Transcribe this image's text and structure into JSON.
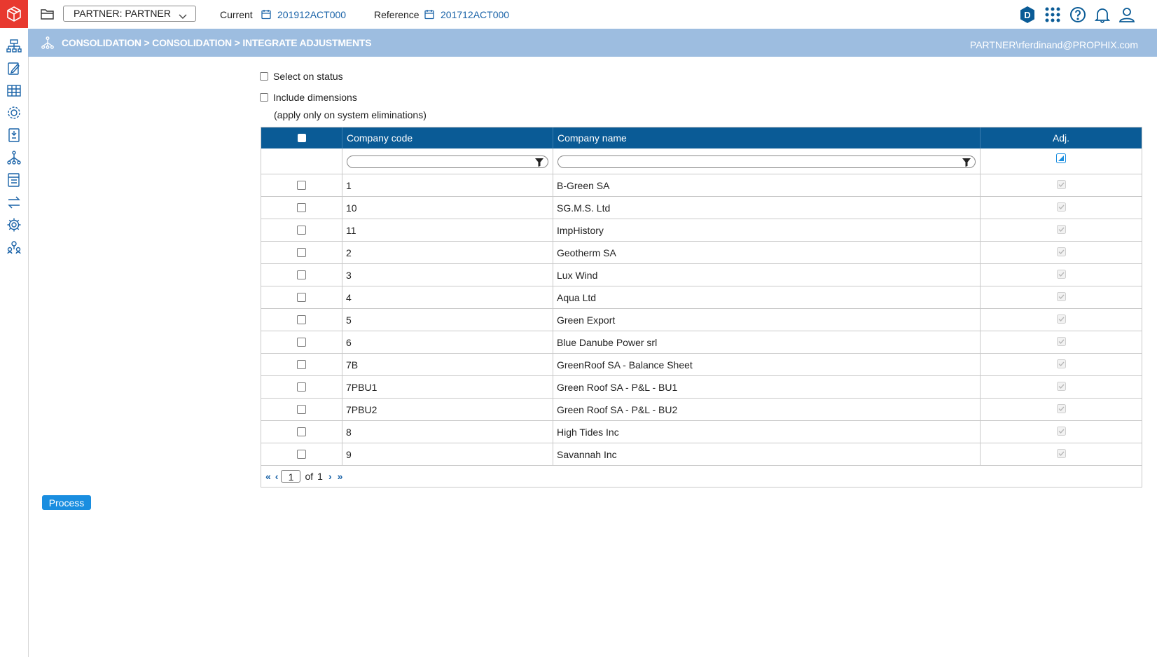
{
  "header": {
    "partner_select": "PARTNER: PARTNER",
    "current_label": "Current",
    "current_value": "201912ACT000",
    "reference_label": "Reference",
    "reference_value": "201712ACT000",
    "user_initial": "D"
  },
  "banner": {
    "breadcrumb": "CONSOLIDATION > CONSOLIDATION > INTEGRATE ADJUSTMENTS",
    "user": "PARTNER\\rferdinand@PROPHIX.com"
  },
  "options": {
    "select_on_status": "Select on status",
    "include_dimensions": "Include dimensions",
    "note": "(apply only on system eliminations)"
  },
  "table": {
    "columns": [
      "Company code",
      "Company name",
      "Adj."
    ],
    "rows": [
      {
        "code": "1",
        "name": "B-Green SA"
      },
      {
        "code": "10",
        "name": "SG.M.S. Ltd"
      },
      {
        "code": "11",
        "name": "ImpHistory"
      },
      {
        "code": "2",
        "name": "Geotherm SA"
      },
      {
        "code": "3",
        "name": "Lux Wind"
      },
      {
        "code": "4",
        "name": "Aqua Ltd"
      },
      {
        "code": "5",
        "name": "Green Export"
      },
      {
        "code": "6",
        "name": "Blue Danube Power srl"
      },
      {
        "code": "7B",
        "name": "GreenRoof SA - Balance Sheet"
      },
      {
        "code": "7PBU1",
        "name": "Green Roof SA - P&L - BU1"
      },
      {
        "code": "7PBU2",
        "name": "Green Roof SA - P&L - BU2"
      },
      {
        "code": "8",
        "name": "High Tides Inc"
      },
      {
        "code": "9",
        "name": "Savannah Inc"
      }
    ]
  },
  "pager": {
    "page": "1",
    "of_label": "of",
    "total": "1"
  },
  "actions": {
    "process": "Process"
  },
  "colors": {
    "brand_red": "#e8392f",
    "banner_blue": "#9dbde0",
    "header_blue": "#0a5b96",
    "link_blue": "#1a63a8",
    "button_blue": "#1a8ee0"
  }
}
